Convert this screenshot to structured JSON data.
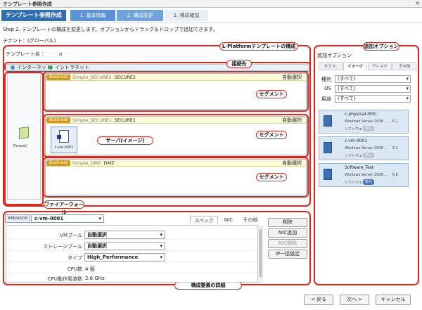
{
  "window": {
    "title": "テンプレート参照作成",
    "close": "×"
  },
  "steps": [
    {
      "label": "テンプレート参照作成"
    },
    {
      "label": "1. 基本情報"
    },
    {
      "label": "2. 構成変更"
    },
    {
      "label": "3. 構成確認"
    }
  ],
  "instructions": "Step 2. テンプレートの構成を変更します。オプションからドラッグ＆ドロップで追加できます。",
  "tenant": "テナント：(グローバル)",
  "template": {
    "label": "テンプレート名 ：",
    "value": "a"
  },
  "callouts": {
    "structure": "L-Platformテンプレートの構成",
    "connection": "接続先",
    "segment": "セグメント",
    "server": "サーバ(イメージ)",
    "firewall": "ファイアーウォール",
    "options": "追加オプション",
    "details": "構成要素の詳細"
  },
  "network": {
    "internet": "インターネット",
    "intranet": "イントラネット"
  },
  "firewall_label": "Firewall",
  "segments": [
    {
      "badge": "Business",
      "name": "Simple_SECURE2",
      "alias": "SECURE2",
      "mode": "自動選択"
    },
    {
      "badge": "Business",
      "name": "Simple_SECURE1",
      "alias": "SECURE1",
      "mode": "自動選択"
    },
    {
      "badge": "Business",
      "name": "Simple_DMZ",
      "alias": "DMZ",
      "mode": "自動選択"
    }
  ],
  "server_node": {
    "label": "c-vm-0001"
  },
  "options": {
    "title": "追加オプション",
    "tabs": [
      "セグメ.",
      "イメージ",
      "ディスク",
      "その他"
    ],
    "filters": [
      {
        "label": "種別",
        "value": "(すべて)"
      },
      {
        "label": "OS",
        "value": "(すべて)"
      },
      {
        "label": "用途",
        "value": "(すべて)"
      }
    ],
    "items": [
      {
        "name": "c-physical-000...",
        "os": "Windows Server 2008 ...",
        "ver": "6.1",
        "sw_label": "ソフトウェア",
        "flag": "なし"
      },
      {
        "name": "c-vm-0001",
        "os": "Windows Server 2008 ...",
        "ver": "6.1",
        "sw_label": "ソフトウェア",
        "flag": "なし"
      },
      {
        "name": "Software_Test",
        "os": "Windows Server 2008 ...",
        "ver": "6.0",
        "sw_label": "ソフトウェア",
        "flag": "あり"
      }
    ]
  },
  "details": {
    "tag": "WEB/AP/DB",
    "server": "c-vm-0001",
    "tabs": [
      "スペック",
      "NIC",
      "その他"
    ],
    "rows": [
      {
        "label": "VMプール",
        "value": "自動選択",
        "type": "select"
      },
      {
        "label": "ストレージプール",
        "value": "自動選択",
        "type": "select"
      },
      {
        "label": "タイプ",
        "value": "High_Performance",
        "type": "select"
      },
      {
        "label": "CPU数",
        "value": "4 個",
        "type": "text"
      },
      {
        "label": "CPU動作周波数",
        "value": "2.6 GHz",
        "type": "text"
      }
    ],
    "buttons": [
      "削除",
      "NIC追加",
      "NIC削除",
      "IP一括設定"
    ]
  },
  "footer": {
    "back": "< 戻る",
    "next": "次へ >",
    "cancel": "キャンセル"
  }
}
